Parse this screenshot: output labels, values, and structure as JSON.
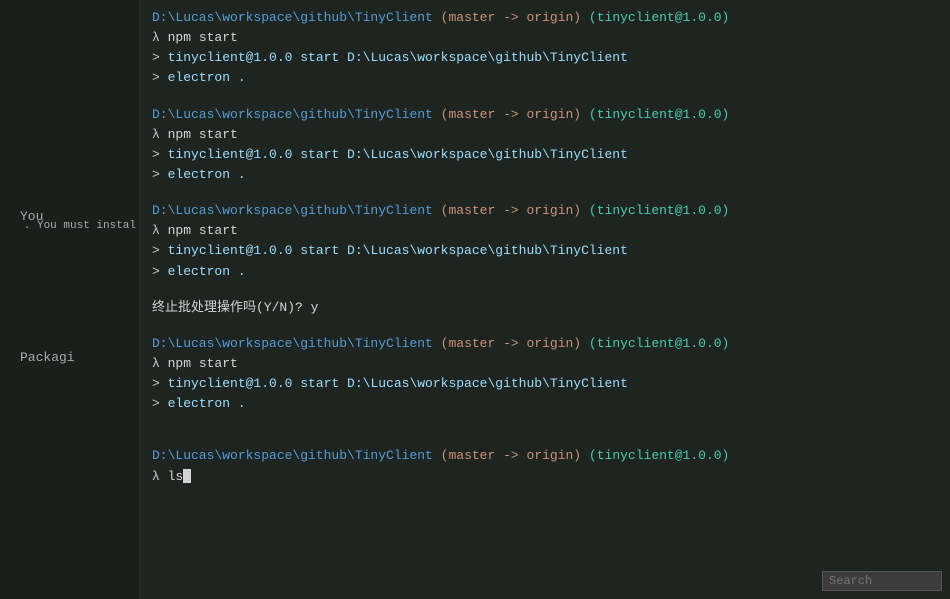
{
  "sidebar": {
    "you_label": "You",
    "install_hint": ". You must instal",
    "packagi_label": "Packagi"
  },
  "terminal": {
    "blocks": [
      {
        "path": "D:\\Lucas\\workspace\\github\\TinyClient",
        "git": "(master -> origin)",
        "pkg": "(tinyclient@1.0.0)",
        "lambda_cmd": "λ npm start",
        "outputs": [
          "> tinyclient@1.0.0 start D:\\Lucas\\workspace\\github\\TinyClient",
          "> electron ."
        ]
      },
      {
        "path": "D:\\Lucas\\workspace\\github\\TinyClient",
        "git": "(master -> origin)",
        "pkg": "(tinyclient@1.0.0)",
        "lambda_cmd": "λ npm start",
        "outputs": [
          "> tinyclient@1.0.0 start D:\\Lucas\\workspace\\github\\TinyClient",
          "> electron ."
        ]
      },
      {
        "path": "D:\\Lucas\\workspace\\github\\TinyClient",
        "git": "(master -> origin)",
        "pkg": "(tinyclient@1.0.0)",
        "lambda_cmd": "λ npm start",
        "outputs": [
          "> tinyclient@1.0.0 start D:\\Lucas\\workspace\\github\\TinyClient",
          "> electron ."
        ],
        "extra": "终止批处理操作吗(Y/N)? y"
      },
      {
        "path": "D:\\Lucas\\workspace\\github\\TinyClient",
        "git": "(master -> origin)",
        "pkg": "(tinyclient@1.0.0)",
        "lambda_cmd": "λ npm start",
        "outputs": [
          "> tinyclient@1.0.0 start D:\\Lucas\\workspace\\github\\TinyClient",
          "> electron ."
        ]
      },
      {
        "path": "D:\\Lucas\\workspace\\github\\TinyClient",
        "git": "(master -> origin)",
        "pkg": "(tinyclient@1.0.0)",
        "lambda_cmd": "λ ls",
        "outputs": []
      }
    ]
  },
  "search": {
    "placeholder": "Search",
    "value": ""
  }
}
